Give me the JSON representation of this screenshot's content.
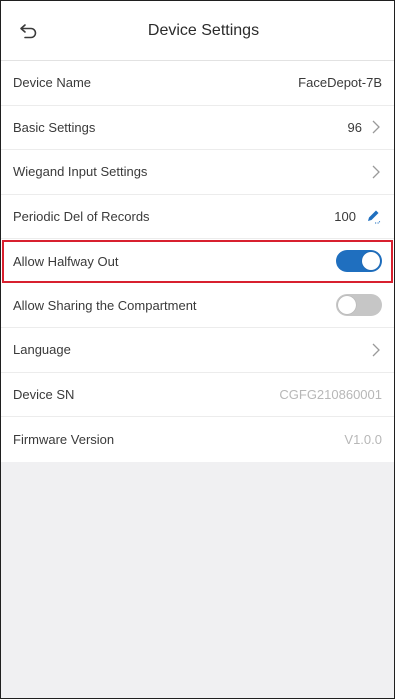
{
  "header": {
    "title": "Device Settings",
    "back_icon": "back-arrow-icon"
  },
  "colors": {
    "accent": "#1f6fbf",
    "highlight": "#d8202f",
    "toggle_off": "#c6c6c6"
  },
  "rows": [
    {
      "label": "Device Name",
      "value": "FaceDepot-7B"
    },
    {
      "label": "Basic Settings",
      "value": "96",
      "icon": "chevron-right-icon"
    },
    {
      "label": "Wiegand Input Settings",
      "value": "",
      "icon": "chevron-right-icon"
    },
    {
      "label": "Periodic Del of Records",
      "value": "100",
      "icon": "pencil-icon"
    },
    {
      "label": "Allow Halfway Out",
      "toggle": "on"
    },
    {
      "label": "Allow Sharing the Compartment",
      "toggle": "off"
    },
    {
      "label": "Language",
      "icon": "chevron-right-icon"
    },
    {
      "label": "Device SN",
      "value": "CGFG210860001"
    },
    {
      "label": "Firmware Version",
      "value": "V1.0.0"
    }
  ]
}
